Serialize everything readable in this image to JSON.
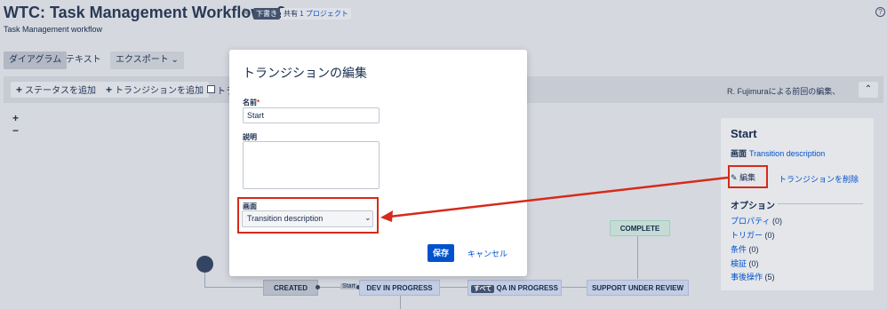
{
  "header": {
    "title": "WTC: Task Management Workflow v2",
    "draft_badge": "下書き",
    "shared_prefix": "共有",
    "shared_link": "1 プロジェクト",
    "subtitle": "Task Management workflow",
    "help_glyph": "?"
  },
  "tabs": [
    {
      "label": "ダイアグラム",
      "active": true
    },
    {
      "label": "テキスト",
      "active": false
    },
    {
      "label": "エクスポート ⌄",
      "active": false
    }
  ],
  "toolbar": {
    "add_status": "ステータスを追加",
    "add_transition": "トランジションを追加",
    "checkbox_label": "トラ",
    "last_edit": "R. Fujimuraによる前回の編集、",
    "collapse_glyph": "⌃"
  },
  "canvas": {
    "zoom_in": "+",
    "zoom_out": "−",
    "statuses": {
      "created": "CREATED",
      "dev": "DEV IN PROGRESS",
      "qa": "QA IN PROGRESS",
      "support": "SUPPORT UNDER REVIEW",
      "complete": "COMPLETE"
    },
    "start_label": "Start",
    "all_badge": "すべて"
  },
  "dialog": {
    "title": "トランジションの編集",
    "name_label": "名前",
    "required_mark": "*",
    "name_value": "Start",
    "desc_label": "説明",
    "screen_label": "画面",
    "screen_value": "Transition description",
    "save_label": "保存",
    "cancel_label": "キャンセル"
  },
  "panel": {
    "title": "Start",
    "screen_label": "画面",
    "screen_value": "Transition description",
    "edit_label": "編集",
    "delete_label": "トランジションを削除",
    "options_title": "オプション",
    "options": [
      {
        "label": "プロパティ",
        "count": "(0)"
      },
      {
        "label": "トリガー",
        "count": "(0)"
      },
      {
        "label": "条件",
        "count": "(0)"
      },
      {
        "label": "検証",
        "count": "(0)"
      },
      {
        "label": "事後操作",
        "count": "(5)"
      }
    ]
  },
  "colors": {
    "highlight": "#d62a1b",
    "primary": "#0052cc"
  }
}
